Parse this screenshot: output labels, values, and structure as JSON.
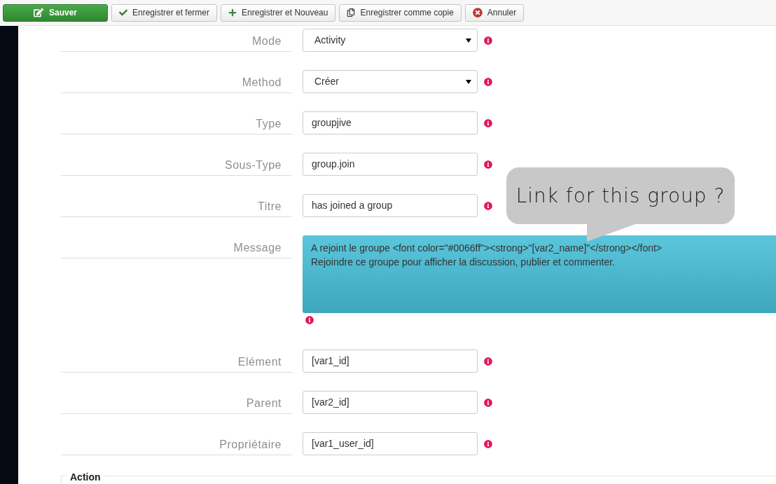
{
  "toolbar": [
    {
      "kind": "primary",
      "label": "Sauver"
    },
    {
      "kind": "default",
      "label": "Enregistrer et fermer"
    },
    {
      "kind": "default",
      "label": "Enregistrer et Nouveau"
    },
    {
      "kind": "default",
      "label": "Enregistrer comme copie"
    },
    {
      "kind": "default",
      "label": "Annuler"
    }
  ],
  "fields": [
    {
      "label": "Mode",
      "kind": "select",
      "value": "Activity"
    },
    {
      "label": "Method",
      "kind": "select",
      "value": "Créer"
    },
    {
      "label": "Type",
      "kind": "text",
      "value": "groupjive"
    },
    {
      "label": "Sous-Type",
      "kind": "text",
      "value": "group.join"
    },
    {
      "label": "Titre",
      "kind": "text",
      "value": "has joined a group"
    },
    {
      "label": "Message",
      "kind": "textarea",
      "lines": [
        "A rejoint le groupe <font color=\"#0066ff\"><strong>\"[var2_name]\"</strong></font>",
        "Rejoindre ce groupe pour afficher la discussion, publier et commenter."
      ]
    },
    {
      "label": "Elément",
      "kind": "text",
      "value": "[var1_id]"
    },
    {
      "label": "Parent",
      "kind": "text",
      "value": "[var2_id]"
    },
    {
      "label": "Propriétaire",
      "kind": "text",
      "value": "[var1_user_id]"
    }
  ],
  "section": {
    "legend": "Action"
  },
  "callout": {
    "text": "Link for this group ?"
  }
}
